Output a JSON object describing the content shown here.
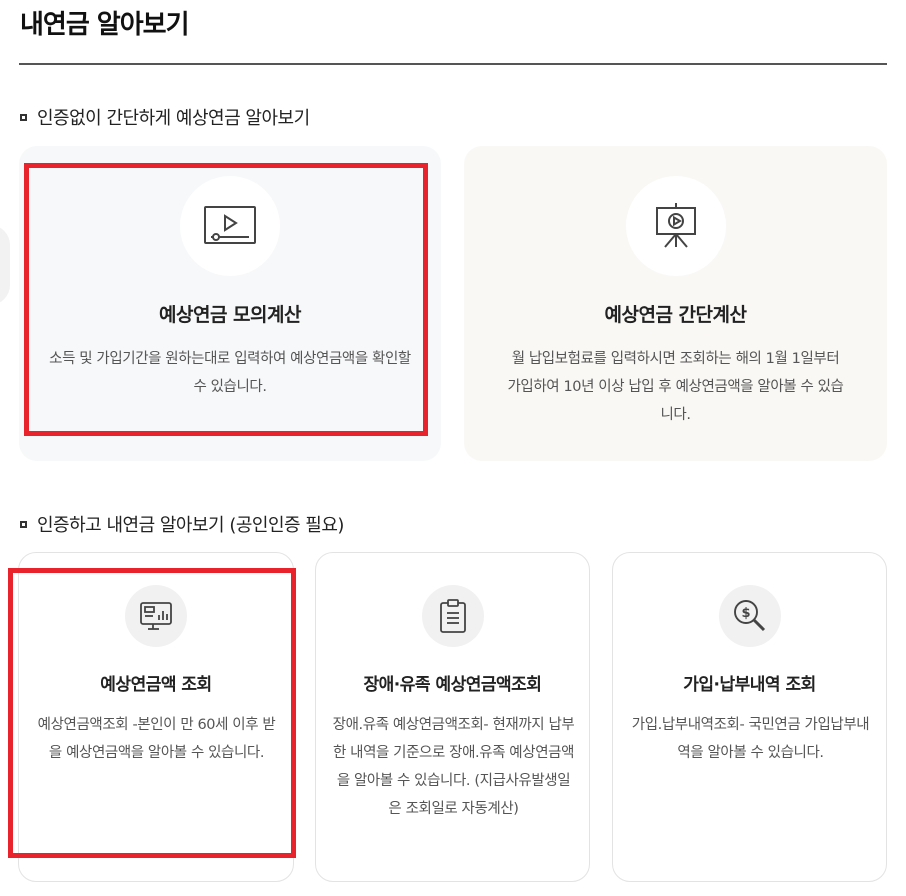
{
  "page": {
    "title": "내연금 알아보기"
  },
  "section_no_auth": {
    "heading": "인증없이 간단하게 예상연금 알아보기",
    "cards": [
      {
        "title": "예상연금 모의계산",
        "desc": "소득 및 가입기간을 원하는대로 입력하여 예상연금액을 확인할 수 있습니다.",
        "icon": "video-player-icon"
      },
      {
        "title": "예상연금 간단계산",
        "desc": "월 납입보험료를 입력하시면 조회하는 해의 1월 1일부터 가입하여 10년 이상 납입 후 예상연금액을 알아볼 수 있습니다.",
        "icon": "presentation-board-icon"
      }
    ]
  },
  "section_auth": {
    "heading": "인증하고 내연금 알아보기 (공인인증 필요)",
    "cards": [
      {
        "title": "예상연금액 조회",
        "desc": "예상연금액조회 -본인이 만 60세 이후 받을 예상연금액을 알아볼 수 있습니다.",
        "icon": "monitor-chart-icon"
      },
      {
        "title": "장애·유족 예상연금액조회",
        "desc": "장애.유족 예상연금액조회- 현재까지 납부한 내역을 기준으로 장애.유족 예상연금액을 알아볼 수 있습니다. (지급사유발생일은 조회일로 자동계산)",
        "icon": "clipboard-icon"
      },
      {
        "title": "가입·납부내역 조회",
        "desc": "가입.납부내역조회- 국민연금 가입납부내역을 알아볼 수 있습니다.",
        "icon": "money-search-icon"
      }
    ]
  },
  "colors": {
    "highlight": "#e8232b",
    "icon_stroke": "#444444"
  }
}
